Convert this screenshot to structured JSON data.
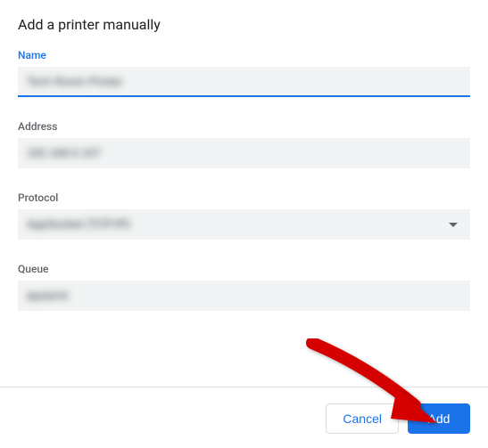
{
  "dialog": {
    "title": "Add a printer manually"
  },
  "fields": {
    "name": {
      "label": "Name",
      "value": "Tech Room Printer"
    },
    "address": {
      "label": "Address",
      "value": "192.168.0.107"
    },
    "protocol": {
      "label": "Protocol",
      "value": "AppSocket (TCP/IP)"
    },
    "queue": {
      "label": "Queue",
      "value": "ipp/print"
    }
  },
  "buttons": {
    "cancel": "Cancel",
    "add": "Add"
  },
  "colors": {
    "accent": "#1a73e8",
    "field_bg": "#f1f3f4",
    "label": "#5f6368"
  }
}
